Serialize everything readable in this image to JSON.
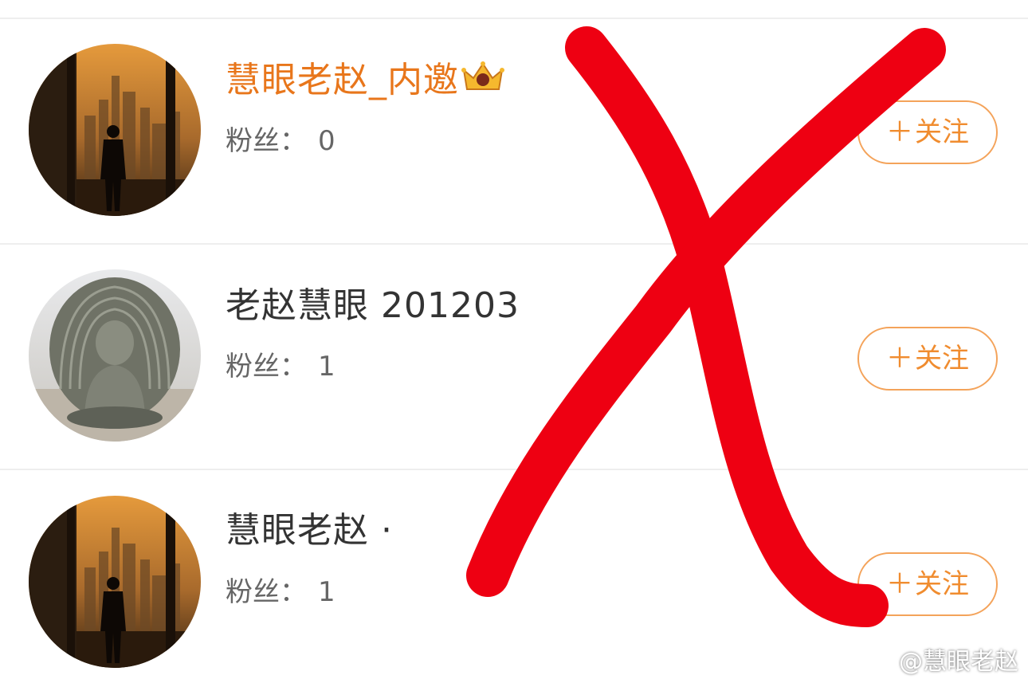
{
  "users": [
    {
      "name": "慧眼老赵_内邀",
      "fans_label": "粉丝：",
      "fans_count": "0",
      "follow_label": "关注",
      "avatar": "city-skyline-silhouette",
      "vip": true
    },
    {
      "name": "老赵慧眼 201203",
      "fans_label": "粉丝：",
      "fans_count": "1",
      "follow_label": "关注",
      "avatar": "buddha-statue"
    },
    {
      "name": "慧眼老赵 ·",
      "fans_label": "粉丝：",
      "fans_count": "1",
      "follow_label": "关注",
      "avatar": "city-skyline-silhouette"
    }
  ],
  "icons": {
    "follow": "plus-icon",
    "vip": "crown-icon",
    "watermark": "weibo-icon",
    "overlay": "red-x-mark"
  },
  "watermark": "@慧眼老赵",
  "colors": {
    "accent": "#f08c2f",
    "vip_name": "#e8761b",
    "text": "#333333",
    "secondary": "#666666",
    "divider": "#eeeeee",
    "cross": "#ee0012"
  }
}
